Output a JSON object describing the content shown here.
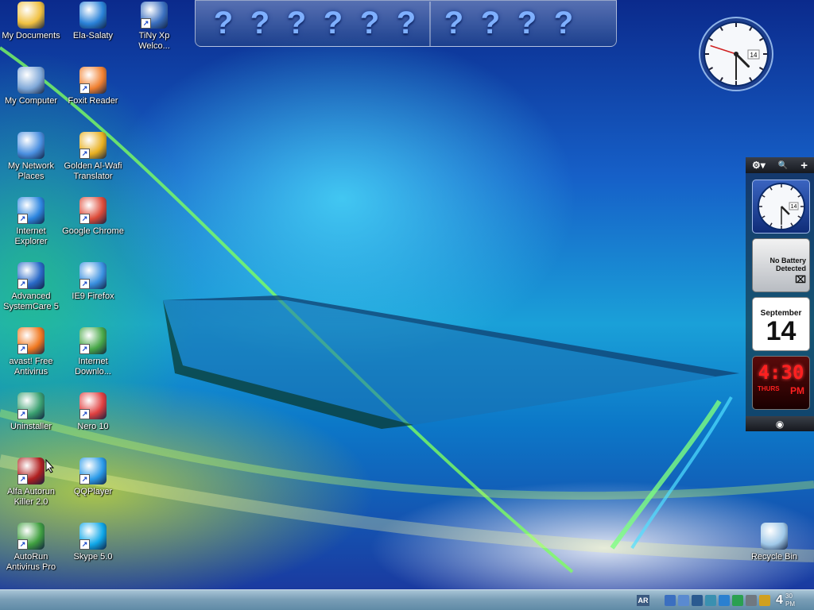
{
  "desktop": {
    "icons": [
      {
        "label": "My Documents",
        "icon": "folder-documents-icon",
        "color": "#f0c040"
      },
      {
        "label": "Ela-Salaty",
        "icon": "mosque-app-icon",
        "color": "#2a82d8"
      },
      {
        "label": "TiNy Xp Welco...",
        "icon": "tinyxp-icon",
        "color": "#3b70c0"
      },
      {
        "label": "My Computer",
        "icon": "computer-icon",
        "color": "#7fa8d8"
      },
      {
        "label": "Foxit Reader",
        "icon": "foxit-reader-icon",
        "color": "#f08030"
      },
      {
        "label": "My Network Places",
        "icon": "network-places-icon",
        "color": "#4a8fe0"
      },
      {
        "label": "Golden Al-Wafi Translator",
        "icon": "translator-icon",
        "color": "#e8b020"
      },
      {
        "label": "Internet Explorer",
        "icon": "internet-explorer-icon",
        "color": "#2d86e0"
      },
      {
        "label": "Google Chrome",
        "icon": "chrome-icon",
        "color": "#dd4b39"
      },
      {
        "label": "Advanced SystemCare 5",
        "icon": "systemcare-icon",
        "color": "#2a6ac8"
      },
      {
        "label": "IE9 Firefox",
        "icon": "ie9-firefox-icon",
        "color": "#3a90e0"
      },
      {
        "label": "avast! Free Antivirus",
        "icon": "avast-icon",
        "color": "#f07820"
      },
      {
        "label": "Internet Downlo...",
        "icon": "internet-download-icon",
        "color": "#48a848"
      },
      {
        "label": "Uninstaller",
        "icon": "uninstaller-icon",
        "color": "#3aa070"
      },
      {
        "label": "Nero 10",
        "icon": "nero-icon",
        "color": "#e04040"
      },
      {
        "label": "Alfa Autorun Killer 2.0",
        "icon": "autorun-killer-icon",
        "color": "#b02020"
      },
      {
        "label": "QQPlayer",
        "icon": "qqplayer-icon",
        "color": "#2a9ae8"
      },
      {
        "label": "AutoRun Antivirus Pro",
        "icon": "autorun-antivirus-icon",
        "color": "#40a040"
      },
      {
        "label": "Skype 5.0",
        "icon": "skype-icon",
        "color": "#10a8e8"
      },
      {
        "label": "Recycle Bin",
        "icon": "recycle-bin-icon",
        "color": "#9fc8e8"
      }
    ]
  },
  "quicklaunch": {
    "group_a": [
      "?",
      "?",
      "?",
      "?",
      "?",
      "?"
    ],
    "group_b": [
      "?",
      "?",
      "?",
      "?"
    ]
  },
  "clock_widget": {
    "date_badge": "14",
    "hour": 4,
    "minute": 30,
    "second": 48
  },
  "sidebar": {
    "toolbar": {
      "settings": "⚙▾",
      "search": "🔍",
      "add": "+"
    },
    "clock": {
      "date_badge": "14"
    },
    "battery": {
      "line1": "No Battery",
      "line2": "Detected"
    },
    "calendar": {
      "month": "September",
      "day": "14"
    },
    "digital_clock": {
      "time": "4:30",
      "day": "THURS",
      "ampm": "PM"
    }
  },
  "taskbar": {
    "language": "AR",
    "clock": {
      "hour": "4",
      "minutes": "30",
      "ampm": "PM"
    },
    "tray_icons": [
      "network-icon",
      "monitor-icon",
      "display-icon",
      "chart-icon",
      "browser-icon",
      "security-shield-icon",
      "tools-icon",
      "info-icon"
    ]
  }
}
